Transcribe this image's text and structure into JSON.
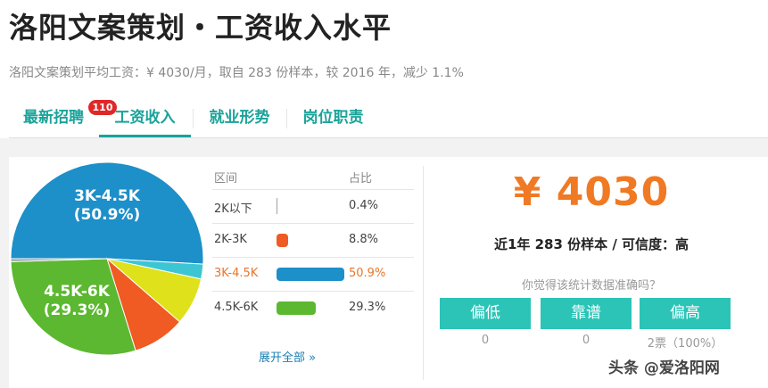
{
  "header": {
    "title": "洛阳文案策划・工资收入水平",
    "subtitle": "洛阳文案策划平均工资：¥ 4030/月，取自 283 份样本，较 2016 年，减少 1.1%"
  },
  "tabs": [
    {
      "label": "最新招聘",
      "badge": "110"
    },
    {
      "label": "工资收入"
    },
    {
      "label": "就业形势"
    },
    {
      "label": "岗位职责"
    }
  ],
  "table": {
    "headers": [
      "区间",
      "占比"
    ],
    "rows": [
      {
        "range": "2K以下",
        "pct": "0.4%",
        "value": 0.4,
        "color": "#9aa3a8"
      },
      {
        "range": "2K-3K",
        "pct": "8.8%",
        "value": 8.8,
        "color": "#ef5b22"
      },
      {
        "range": "3K-4.5K",
        "pct": "50.9%",
        "value": 50.9,
        "color": "#1d8fc9"
      },
      {
        "range": "4.5K-6K",
        "pct": "29.3%",
        "value": 29.3,
        "color": "#5cb830"
      }
    ],
    "expand_label": "展开全部 »"
  },
  "pie": {
    "labels": [
      {
        "range": "3K-4.5K",
        "pct": "(50.9%)"
      },
      {
        "range": "4.5K-6K",
        "pct": "(29.3%)"
      }
    ],
    "slices": [
      {
        "value": 50.9,
        "color": "#1d8fc9"
      },
      {
        "value": 2.5,
        "color": "#3cc6d4"
      },
      {
        "value": 8.0,
        "color": "#dfe11a"
      },
      {
        "value": 8.8,
        "color": "#ef5b22"
      },
      {
        "value": 29.3,
        "color": "#5cb830"
      },
      {
        "value": 0.5,
        "color": "#9aa3a8"
      }
    ]
  },
  "summary": {
    "salary": "¥ 4030",
    "meta": "近1年 283 份样本 / 可信度：高",
    "question": "你觉得该统计数据准确吗？"
  },
  "vote": [
    {
      "label": "偏低",
      "count": "0"
    },
    {
      "label": "靠谱",
      "count": "0"
    },
    {
      "label": "偏高",
      "count": "2票（100%）"
    }
  ],
  "watermark": "头条 @爱洛阳网",
  "colors": {
    "accent": "#1aa39a",
    "button": "#2bc4b7",
    "salary": "#f07a24",
    "badge": "#e02828"
  }
}
